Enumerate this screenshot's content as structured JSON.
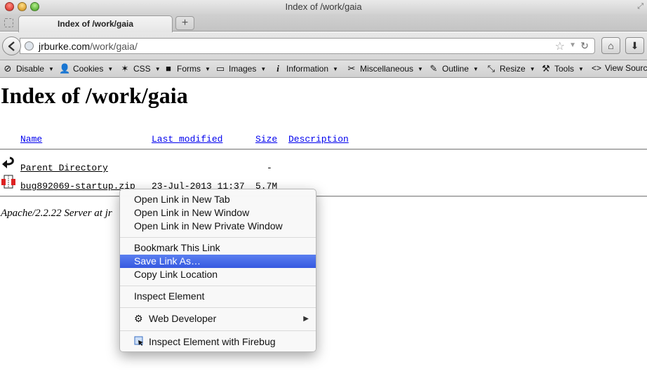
{
  "window": {
    "title": "Index of /work/gaia"
  },
  "tabs": [
    {
      "label": "Index of /work/gaia"
    }
  ],
  "newtab_label": "+",
  "urlbar": {
    "host": "jrburke.com",
    "path": "/work/gaia/"
  },
  "devbar": {
    "items": [
      {
        "label": "Disable",
        "icon": "disable-icon"
      },
      {
        "label": "Cookies",
        "icon": "user-icon"
      },
      {
        "label": "CSS",
        "icon": "wand-icon"
      },
      {
        "label": "Forms",
        "icon": "briefcase-icon"
      },
      {
        "label": "Images",
        "icon": "image-icon"
      },
      {
        "label": "Information",
        "icon": "info-icon"
      },
      {
        "label": "Miscellaneous",
        "icon": "tools-icon"
      },
      {
        "label": "Outline",
        "icon": "pencil-icon"
      },
      {
        "label": "Resize",
        "icon": "resize-icon"
      },
      {
        "label": "Tools",
        "icon": "wrench-icon"
      },
      {
        "label": "View Source",
        "icon": "code-icon"
      }
    ]
  },
  "page": {
    "title": "Index of /work/gaia",
    "columns": {
      "name": "Name",
      "last_modified": "Last modified",
      "size": "Size",
      "description": "Description"
    },
    "rows": [
      {
        "name": "Parent Directory",
        "modified": "",
        "size": "-",
        "icon": "back-arrow-icon"
      },
      {
        "name": "bug892069-startup.zip",
        "modified": "23-Jul-2013 11:37",
        "size": "5.7M",
        "icon": "archive-icon"
      }
    ],
    "footer": "Apache/2.2.22 Server at jr"
  },
  "context_menu": {
    "items": [
      {
        "label": "Open Link in New Tab"
      },
      {
        "label": "Open Link in New Window"
      },
      {
        "label": "Open Link in New Private Window"
      },
      {
        "label": "Bookmark This Link"
      },
      {
        "label": "Save Link As…",
        "highlighted": true
      },
      {
        "label": "Copy Link Location"
      },
      {
        "label": "Inspect Element"
      },
      {
        "label": "Web Developer",
        "icon": "gear-icon",
        "submenu": true
      },
      {
        "label": "Inspect Element with Firebug",
        "icon": "firebug-inspect-icon"
      }
    ]
  },
  "colors": {
    "link": "#0000ee",
    "menu_highlight": "#3f63e6"
  }
}
